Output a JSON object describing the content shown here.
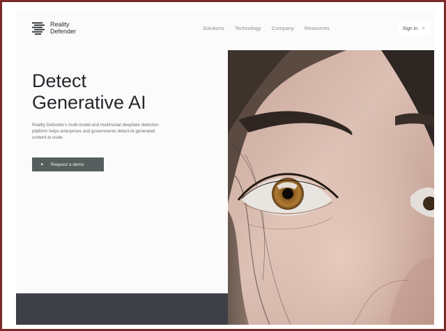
{
  "brand": {
    "line1": "Reality",
    "line2": "Defender"
  },
  "nav": {
    "items": [
      "Solutions",
      "Technology",
      "Company",
      "Resources"
    ]
  },
  "header": {
    "signin_label": "Sign in",
    "signin_icon": "arrow-up-right-icon"
  },
  "hero": {
    "title_line1": "Detect",
    "title_line2": "Generative AI",
    "description": "Reality Defender's multi-model and multimodal deepfake detection platform helps enterprises and governments detect AI-generated content at scale.",
    "cta_label": "Request a demo"
  },
  "colors": {
    "frame_border": "#7a2a2a",
    "cta_background": "#565e5d",
    "footer_band": "#3f3f47",
    "text_dark": "#24272c"
  }
}
